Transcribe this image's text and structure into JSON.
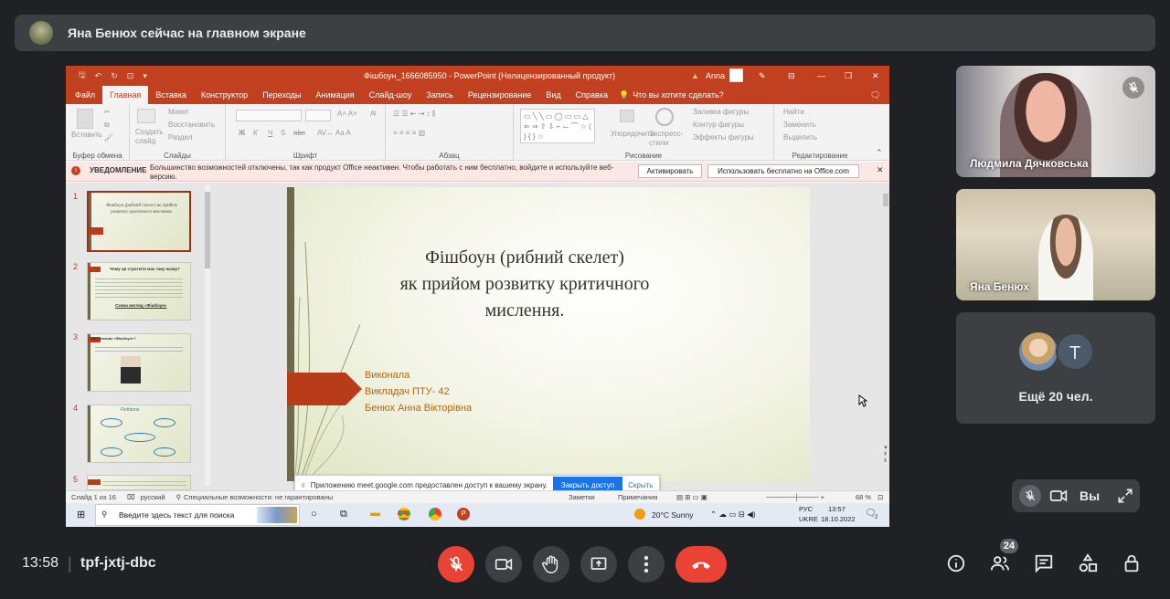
{
  "banner": {
    "text": "Яна Бенюх сейчас на главном экране"
  },
  "ppt": {
    "title": "Фішбоун_1666085950  -  PowerPoint (Нелицензированный продукт)",
    "user": "Anna",
    "warning_icon": "warning-icon",
    "tabs": [
      "Файл",
      "Главная",
      "Вставка",
      "Конструктор",
      "Переходы",
      "Анимация",
      "Слайд-шоу",
      "Запись",
      "Рецензирование",
      "Вид",
      "Справка"
    ],
    "active_tab": "Главная",
    "tell_me": "Что вы хотите сделать?",
    "groups": {
      "clipboard": "Буфер обмена",
      "slides": "Слайды",
      "font": "Шрифт",
      "paragraph": "Абзац",
      "drawing": "Рисование",
      "editing": "Редактирование"
    },
    "ribbon_items": {
      "paste": "Вставить",
      "create_slide": "Создать слайд",
      "layout": "Макет",
      "reset": "Восстановить",
      "section": "Раздел",
      "arrange": "Упорядочить",
      "quick_styles": "Экспресс-стили",
      "shape_fill": "Заливка фигуры",
      "shape_outline": "Контур фигуры",
      "shape_effects": "Эффекты фигуры",
      "find": "Найти",
      "replace": "Заменить",
      "select": "Выделить",
      "font_btns": [
        "Ж",
        "К",
        "Ч",
        "S",
        "abc"
      ]
    },
    "notice": {
      "label": "УВЕДОМЛЕНИЕ",
      "text1": "Большинство возможностей отключены, так как продукт Office неактивен. Чтобы работать с ним бесплатно, войдите и используйте веб-",
      "text2": "версию.",
      "activate": "Активировать",
      "use_free": "Использовать бесплатно на Office.com"
    },
    "thumbs": [
      "1",
      "2",
      "3",
      "4",
      "5"
    ],
    "thumb_texts": {
      "t1": "Фішбоун (рибний скелет) як прийом розвитку критичного мислення.",
      "t2": "Чому ця стратегія має таку назву?",
      "t2b": "Схема вигляд «Фішбоун»",
      "t3": "Що означає «Фішбоун»?",
      "t4": "Fishbone"
    },
    "slide": {
      "title_line1": "Фішбоун (рибний скелет)",
      "title_line2": "як прийом розвитку критичного",
      "title_line3": "мислення.",
      "author_line1": "Виконала",
      "author_line2": "Викладач ПТУ- 42",
      "author_line3": "Бенюх Анна Вікторівна"
    },
    "notify": {
      "text": "Приложению meet.google.com предоставлен доступ к вашему экрану.",
      "stop": "Закрыть доступ",
      "hide": "Скрыть"
    },
    "status": {
      "slide": "Слайд 1 из 16",
      "lang": "русский",
      "access": "Специальные возможности: не гарантированы",
      "notes": "Заметки",
      "comments": "Примечания",
      "zoom": "68 %"
    },
    "taskbar": {
      "search": "Введите здесь текст для поиска",
      "weather": "20°C  Sunny",
      "lang1": "РУС",
      "lang2": "UKRE",
      "time": "13:57",
      "date": "18.10.2022",
      "notif": "2"
    }
  },
  "participants": [
    {
      "name": "Людмила Дячковська"
    },
    {
      "name": "Яна Бенюх"
    }
  ],
  "more": {
    "initial": "Т",
    "label": "Ещё 20 чел."
  },
  "self": {
    "label": "Вы"
  },
  "meeting": {
    "time": "13:58",
    "code": "tpf-jxtj-dbc"
  },
  "people_count": "24",
  "colors": {
    "end_call": "#ea4335",
    "mute_red": "#ea4335",
    "ppt_brand": "#c1401f",
    "blue": "#1a73e8"
  }
}
